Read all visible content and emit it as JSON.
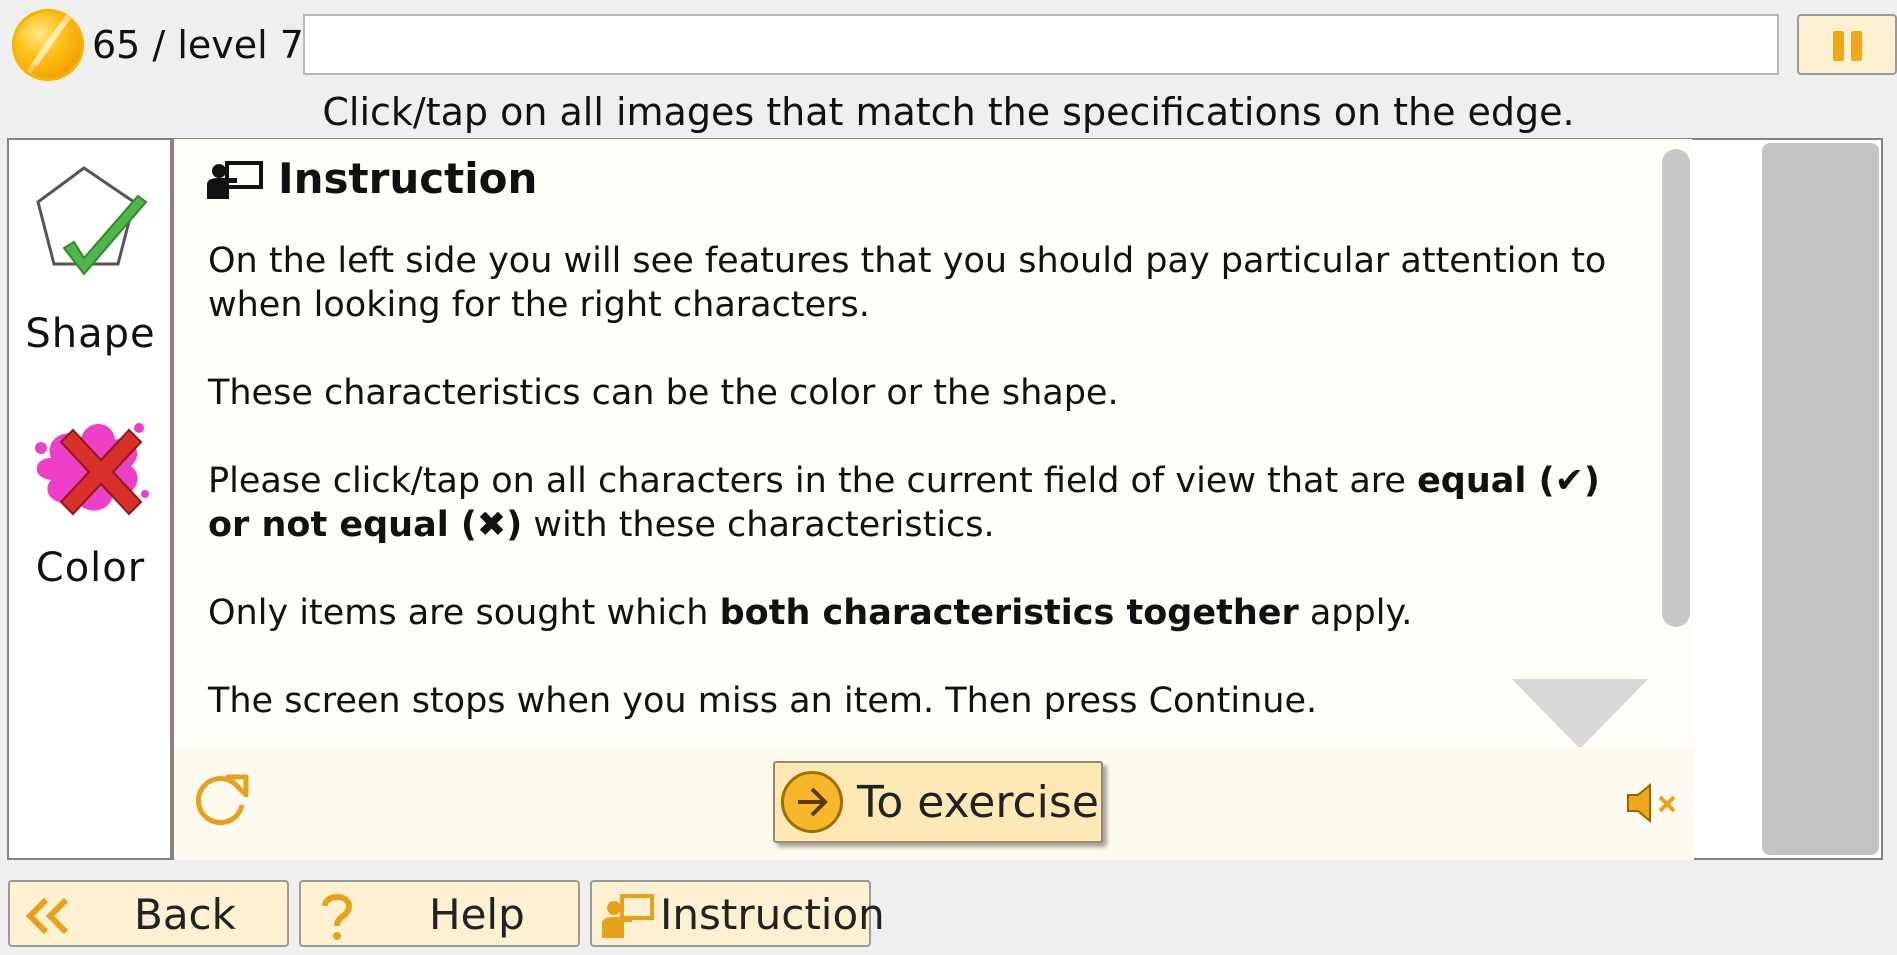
{
  "header": {
    "score_text": "65 / level 7",
    "coin_icon": "coin-icon",
    "pause_icon": "pause-icon"
  },
  "task_text": "Click/tap on all images that match the specifications on the edge.",
  "features": [
    {
      "label": "Shape",
      "icon": "pentagon-check-icon",
      "match": "equal"
    },
    {
      "label": "Color",
      "icon": "pink-splash-cross-icon",
      "match": "not equal"
    }
  ],
  "instruction": {
    "title": "Instruction",
    "title_icon": "presenter-icon",
    "p1": "On the left side you will see features that you should pay particular attention to when looking for the right characters.",
    "p2": "These characteristics can be the color or the shape.",
    "p3_a": "Please click/tap on all characters in the current field of view that are ",
    "p3_b": "equal (✔) or not equal (✖)",
    "p3_c": " with these characteristics.",
    "p4_a": "Only items are sought which ",
    "p4_b": "both characteristics together",
    "p4_c": " apply.",
    "p5": "The screen stops when you miss an item. Then press Continue.",
    "to_exercise": "To exercise",
    "reload_icon": "reload-icon",
    "mute_icon": "speaker-muted-icon"
  },
  "bottom": {
    "back": "Back",
    "help": "Help",
    "instruction": "Instruction"
  },
  "colors": {
    "accent": "#f0a81a",
    "button_bg": "#fdf1d2",
    "panel_bg": "#fffdf8"
  }
}
